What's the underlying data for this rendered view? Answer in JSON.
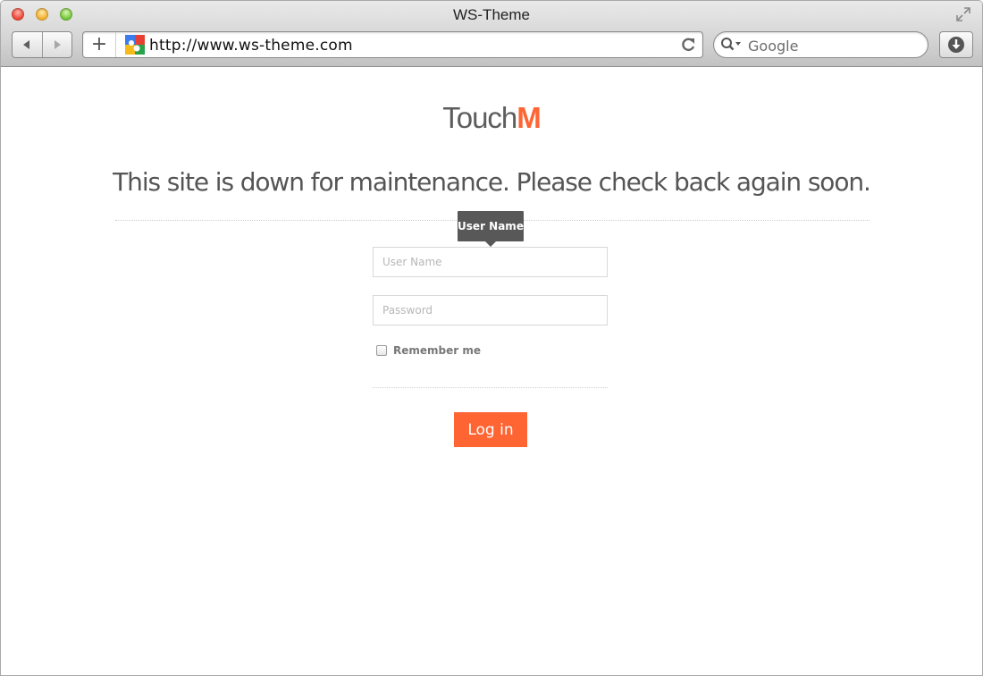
{
  "window": {
    "title": "WS-Theme"
  },
  "toolbar": {
    "back_icon": "back-arrow-icon",
    "forward_icon": "forward-arrow-icon",
    "new_tab_label": "+",
    "url": "http://www.ws-theme.com",
    "search_placeholder": "Google",
    "reload_icon": "reload-icon",
    "download_icon": "download-icon"
  },
  "page": {
    "logo": {
      "part1": "Touch",
      "part2": "M"
    },
    "headline": "This site is down for maintenance. Please check back again soon.",
    "tooltip": "User Name",
    "form": {
      "username_placeholder": "User Name",
      "username_value": "",
      "password_placeholder": "Password",
      "password_value": "",
      "remember_label": "Remember me",
      "remember_checked": false,
      "login_label": "Log in"
    }
  },
  "colors": {
    "accent": "#ff6433",
    "tooltip_bg": "#585858",
    "text_gray": "#555555"
  }
}
